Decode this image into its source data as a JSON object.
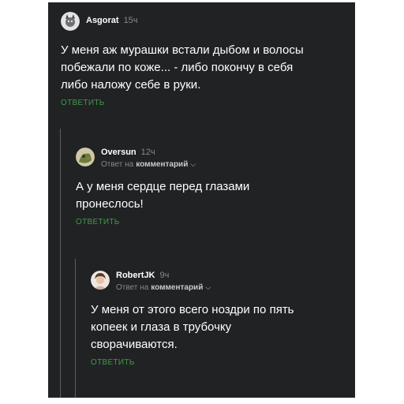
{
  "comments": [
    {
      "author": "Asgorat",
      "time": "15ч",
      "text": "У меня аж мурашки встали дыбом и волосы побежали по коже... - либо покончу в себя либо наложу себе в руки.",
      "reply_label": "ОТВЕТИТЬ"
    },
    {
      "author": "Oversun",
      "time": "12ч",
      "reply_prefix": "Ответ на",
      "reply_target": "комментарий",
      "text": "А у меня сердце перед глазами пронеслось!",
      "reply_label": "ОТВЕТИТЬ"
    },
    {
      "author": "RobertJK",
      "time": "9ч",
      "reply_prefix": "Ответ на",
      "reply_target": "комментарий",
      "text": "У меня от этого всего ноздри по пять копеек и глаза в трубочку сворачиваются.",
      "reply_label": "ОТВЕТИТЬ"
    }
  ],
  "colors": {
    "background": "#212224",
    "accent": "#3f9a4c",
    "muted": "#86888c",
    "text": "#ffffff"
  },
  "icons": {
    "expand": "chevron-down-icon"
  }
}
